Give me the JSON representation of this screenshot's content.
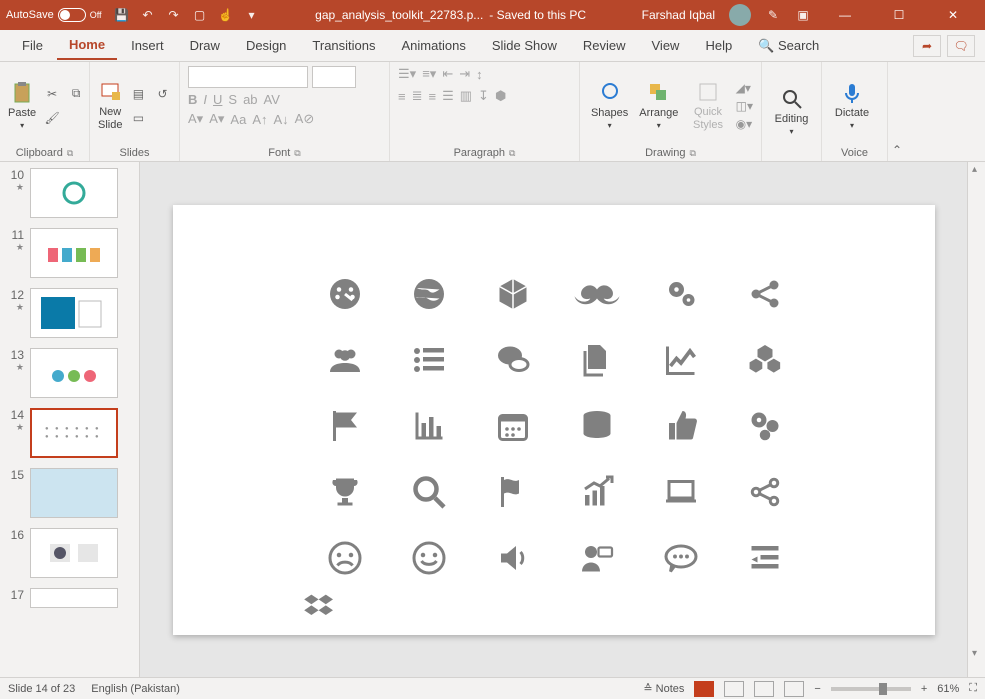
{
  "titlebar": {
    "autosave_label": "AutoSave",
    "autosave_state": "Off",
    "filename": "gap_analysis_toolkit_22783.p...",
    "saved_status": "- Saved to this PC",
    "username": "Farshad Iqbal"
  },
  "tabs": {
    "file": "File",
    "home": "Home",
    "insert": "Insert",
    "draw": "Draw",
    "design": "Design",
    "transitions": "Transitions",
    "animations": "Animations",
    "slideshow": "Slide Show",
    "review": "Review",
    "view": "View",
    "help": "Help",
    "search": "Search"
  },
  "ribbon": {
    "clipboard": {
      "label": "Clipboard",
      "paste": "Paste"
    },
    "slides": {
      "label": "Slides",
      "new_slide": "New\nSlide"
    },
    "font": {
      "label": "Font"
    },
    "paragraph": {
      "label": "Paragraph"
    },
    "drawing": {
      "label": "Drawing",
      "shapes": "Shapes",
      "arrange": "Arrange",
      "quick_styles": "Quick\nStyles"
    },
    "editing": {
      "label": "Editing",
      "btn": "Editing"
    },
    "voice": {
      "label": "Voice",
      "dictate": "Dictate"
    }
  },
  "thumbs": [
    {
      "n": "10"
    },
    {
      "n": "11"
    },
    {
      "n": "12"
    },
    {
      "n": "13"
    },
    {
      "n": "14",
      "selected": true
    },
    {
      "n": "15"
    },
    {
      "n": "16"
    },
    {
      "n": "17"
    }
  ],
  "slide_icons": [
    "gauge",
    "globe",
    "cube",
    "mustache",
    "gears",
    "share",
    "users",
    "list",
    "chat",
    "files",
    "line-chart",
    "cubes",
    "flag",
    "bar-chart",
    "calendar",
    "database",
    "thumbs-up",
    "gears2",
    "trophy",
    "search",
    "flag-wave",
    "growth-chart",
    "laptop",
    "share2",
    "sad-face",
    "happy-face",
    "speaker",
    "user-chat",
    "comments",
    "indent"
  ],
  "extra_icon": "dropbox",
  "status": {
    "slide_counter": "Slide 14 of 23",
    "language": "English (Pakistan)",
    "notes": "Notes",
    "zoom": "61%"
  }
}
